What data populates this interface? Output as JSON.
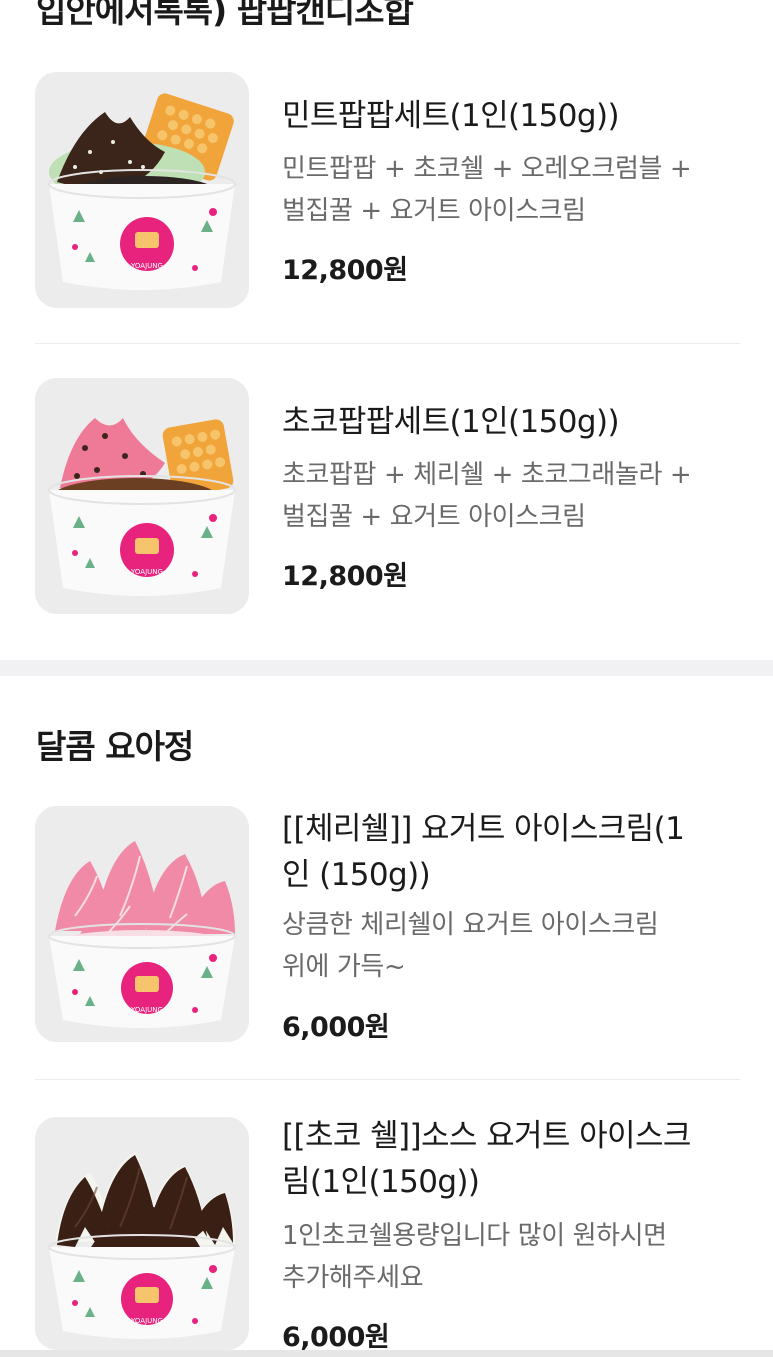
{
  "section1": {
    "title": "입안에서톡톡) 팝팝캔디조합",
    "items": [
      {
        "name": "민트팝팝세트(1인(150g))",
        "desc_line1": "민트팝팝 + 초코쉘 + 오레오크럼블 +",
        "desc_line2": "벌집꿀 + 요거트 아이스크림",
        "price": "12,800원"
      },
      {
        "name": "초코팝팝세트(1인(150g))",
        "desc_line1": "초코팝팝 + 체리쉘 + 초코그래놀라 +",
        "desc_line2": "벌집꿀 + 요거트 아이스크림",
        "price": "12,800원"
      }
    ]
  },
  "section2": {
    "title": "달콤 요아정",
    "items": [
      {
        "name_line1": "[[체리쉘]] 요거트 아이스크림(1",
        "name_line2": "인 (150g))",
        "desc_line1": "상큼한 체리쉘이 요거트 아이스크림",
        "desc_line2": "위에 가득~",
        "price": "6,000원"
      },
      {
        "name_line1": "[[초코 쉘]]소스 요거트 아이스크",
        "name_line2": "림(1인(150g))",
        "desc_line1": "1인초코쉘용량입니다 많이 원하시면",
        "desc_line2": "추가해주세요",
        "price": "6,000원"
      }
    ]
  },
  "colors": {
    "background": "#ffffff",
    "section_gap": "#f1f1f3",
    "desc_text": "#6a6a6a",
    "cup_pink": "#e8237e",
    "cup_green": "#6ab187"
  }
}
